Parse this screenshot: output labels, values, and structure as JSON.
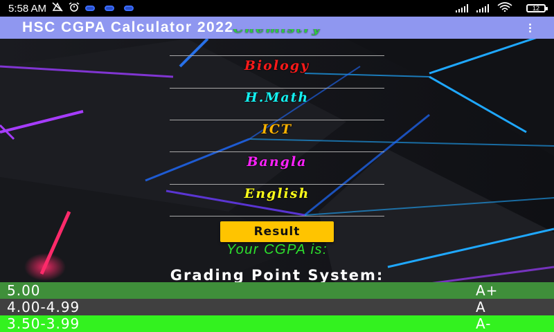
{
  "status_bar": {
    "time": "5:58 AM",
    "battery": "12"
  },
  "app_bar": {
    "title": "HSC CGPA Calculator 2022"
  },
  "subjects": [
    {
      "label": "Chemistry",
      "color": "#2ecc40"
    },
    {
      "label": "Biology",
      "color": "#ff1a1a"
    },
    {
      "label": "H.Math",
      "color": "#14f0f0"
    },
    {
      "label": "ICT",
      "color": "#ffb300"
    },
    {
      "label": "Bangla",
      "color": "#ff22ff"
    },
    {
      "label": "English",
      "color": "#ffff1a"
    }
  ],
  "result_button": "Result",
  "cgpa_label": "Your CGPA is:",
  "grading_title": "Grading Point System:",
  "grading_rows": [
    {
      "range": "5.00",
      "grade": "A+",
      "color": "#3f8f3a"
    },
    {
      "range": "4.00-4.99",
      "grade": "A",
      "color": "#404040"
    },
    {
      "range": "3.50-3.99",
      "grade": "A-",
      "color": "#33f21f"
    }
  ]
}
